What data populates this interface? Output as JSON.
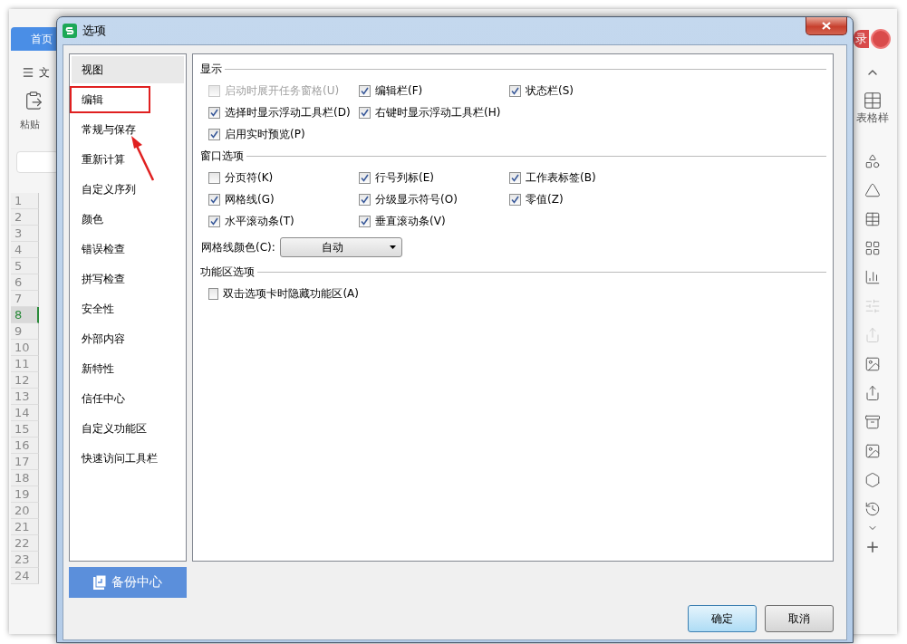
{
  "background_app": {
    "home_tab": "首页",
    "menu_label": "文",
    "paste_label": "粘贴",
    "login_label": "录",
    "table_style_label": "表格样",
    "row_numbers": [
      {
        "label": "1",
        "selected": false
      },
      {
        "label": "2",
        "selected": false
      },
      {
        "label": "3",
        "selected": false
      },
      {
        "label": "4",
        "selected": false
      },
      {
        "label": "5",
        "selected": false
      },
      {
        "label": "6",
        "selected": false
      },
      {
        "label": "7",
        "selected": false
      },
      {
        "label": "8",
        "selected": true
      },
      {
        "label": "9",
        "selected": false
      },
      {
        "label": "10",
        "selected": false
      },
      {
        "label": "11",
        "selected": false
      },
      {
        "label": "12",
        "selected": false
      },
      {
        "label": "13",
        "selected": false
      },
      {
        "label": "14",
        "selected": false
      },
      {
        "label": "15",
        "selected": false
      },
      {
        "label": "16",
        "selected": false
      },
      {
        "label": "17",
        "selected": false
      },
      {
        "label": "18",
        "selected": false
      },
      {
        "label": "19",
        "selected": false
      },
      {
        "label": "20",
        "selected": false
      },
      {
        "label": "21",
        "selected": false
      },
      {
        "label": "22",
        "selected": false
      },
      {
        "label": "23",
        "selected": false
      },
      {
        "label": "24",
        "selected": false
      }
    ]
  },
  "dialog": {
    "title": "选项",
    "nav_items": [
      {
        "label": "视图",
        "selected": true,
        "highlighted": false
      },
      {
        "label": "编辑",
        "selected": false,
        "highlighted": true
      },
      {
        "label": "常规与保存",
        "selected": false,
        "highlighted": false
      },
      {
        "label": "重新计算",
        "selected": false,
        "highlighted": false
      },
      {
        "label": "自定义序列",
        "selected": false,
        "highlighted": false
      },
      {
        "label": "颜色",
        "selected": false,
        "highlighted": false
      },
      {
        "label": "错误检查",
        "selected": false,
        "highlighted": false
      },
      {
        "label": "拼写检查",
        "selected": false,
        "highlighted": false
      },
      {
        "label": "安全性",
        "selected": false,
        "highlighted": false
      },
      {
        "label": "外部内容",
        "selected": false,
        "highlighted": false
      },
      {
        "label": "新特性",
        "selected": false,
        "highlighted": false
      },
      {
        "label": "信任中心",
        "selected": false,
        "highlighted": false
      },
      {
        "label": "自定义功能区",
        "selected": false,
        "highlighted": false
      },
      {
        "label": "快速访问工具栏",
        "selected": false,
        "highlighted": false
      }
    ],
    "backup_button": "备份中心",
    "sections": [
      {
        "title": "显示",
        "rows": [
          [
            {
              "label": "启动时展开任务窗格(U)",
              "checked": false,
              "disabled": true
            },
            {
              "label": "编辑栏(F)",
              "checked": true,
              "disabled": false
            },
            {
              "label": "状态栏(S)",
              "checked": true,
              "disabled": false
            }
          ],
          [
            {
              "label": "选择时显示浮动工具栏(D)",
              "checked": true,
              "disabled": false
            },
            {
              "label": "右键时显示浮动工具栏(H)",
              "checked": true,
              "disabled": false
            }
          ],
          [
            {
              "label": "启用实时预览(P)",
              "checked": true,
              "disabled": false
            }
          ]
        ]
      },
      {
        "title": "窗口选项",
        "rows": [
          [
            {
              "label": "分页符(K)",
              "checked": false,
              "disabled": false
            },
            {
              "label": "行号列标(E)",
              "checked": true,
              "disabled": false
            },
            {
              "label": "工作表标签(B)",
              "checked": true,
              "disabled": false
            }
          ],
          [
            {
              "label": "网格线(G)",
              "checked": true,
              "disabled": false
            },
            {
              "label": "分级显示符号(O)",
              "checked": true,
              "disabled": false
            },
            {
              "label": "零值(Z)",
              "checked": true,
              "disabled": false
            }
          ],
          [
            {
              "label": "水平滚动条(T)",
              "checked": true,
              "disabled": false
            },
            {
              "label": "垂直滚动条(V)",
              "checked": true,
              "disabled": false
            }
          ]
        ],
        "fields": [
          {
            "label": "网格线颜色(C):",
            "value": "自动"
          }
        ]
      },
      {
        "title": "功能区选项",
        "rows": [
          [
            {
              "label": "双击选项卡时隐藏功能区(A)",
              "checked": false,
              "disabled": false
            }
          ]
        ]
      }
    ],
    "buttons": [
      {
        "label": "确定",
        "default": true
      },
      {
        "label": "取消",
        "default": false
      }
    ]
  }
}
